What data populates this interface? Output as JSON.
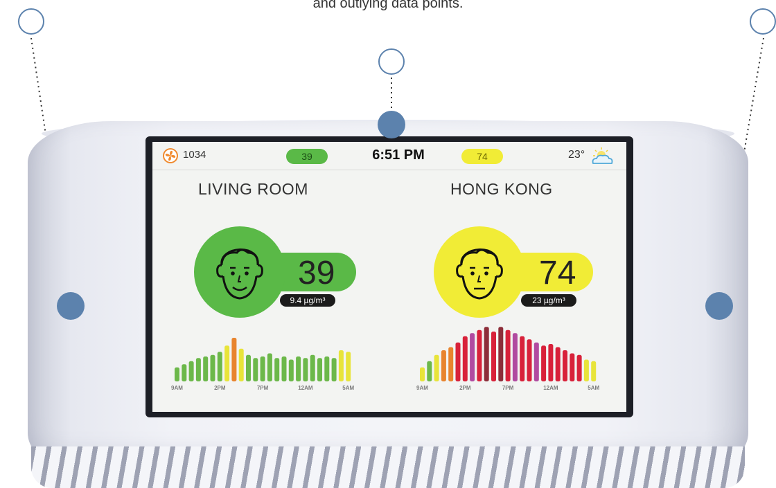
{
  "caption": "and outlying data points.",
  "status_bar": {
    "fan_icon": "fan-icon",
    "fan_count": "1034",
    "indoor_aqi": "39",
    "time": "6:51 PM",
    "outdoor_aqi": "74",
    "temperature": "23°",
    "weather_icon": "partly-cloudy-icon"
  },
  "indoor": {
    "location": "LIVING ROOM",
    "face_icon": "happy-face-icon",
    "aqi": "39",
    "concentration": "9.4 µg/m³",
    "color": "#5ab947"
  },
  "outdoor": {
    "location": "HONG KONG",
    "face_icon": "neutral-face-icon",
    "aqi": "74",
    "concentration": "23 µg/m³",
    "color": "#f1ec36"
  },
  "chart_data": [
    {
      "type": "bar",
      "categories": [
        "9AM",
        "2PM",
        "7PM",
        "12AM",
        "5AM"
      ],
      "values": [
        18,
        22,
        26,
        30,
        32,
        34,
        38,
        46,
        56,
        42,
        34,
        30,
        32,
        36,
        30,
        32,
        28,
        32,
        30,
        34,
        30,
        32,
        30,
        40,
        38
      ],
      "colors": [
        "#6cb84a",
        "#6cb84a",
        "#6cb84a",
        "#6cb84a",
        "#6cb84a",
        "#6cb84a",
        "#6cb84a",
        "#e8e43a",
        "#e8842e",
        "#e8e43a",
        "#6cb84a",
        "#6cb84a",
        "#6cb84a",
        "#6cb84a",
        "#6cb84a",
        "#6cb84a",
        "#6cb84a",
        "#6cb84a",
        "#6cb84a",
        "#6cb84a",
        "#6cb84a",
        "#6cb84a",
        "#6cb84a",
        "#e8e43a",
        "#e8e43a"
      ],
      "ylim": [
        0,
        80
      ]
    },
    {
      "type": "bar",
      "categories": [
        "9AM",
        "2PM",
        "7PM",
        "12AM",
        "5AM"
      ],
      "values": [
        18,
        26,
        34,
        40,
        44,
        50,
        58,
        62,
        66,
        70,
        64,
        70,
        66,
        62,
        58,
        54,
        50,
        46,
        48,
        44,
        40,
        36,
        34,
        28,
        26
      ],
      "colors": [
        "#e8e43a",
        "#6cb84a",
        "#e8e43a",
        "#e8842e",
        "#e8842e",
        "#d8213a",
        "#d8213a",
        "#b14aa0",
        "#d8213a",
        "#8d2e3a",
        "#d8213a",
        "#8d2e3a",
        "#d8213a",
        "#b14aa0",
        "#d8213a",
        "#d8213a",
        "#b14aa0",
        "#d8213a",
        "#d8213a",
        "#d8213a",
        "#d8213a",
        "#d8213a",
        "#d8213a",
        "#e8e43a",
        "#e8e43a"
      ],
      "ylim": [
        0,
        80
      ]
    }
  ],
  "annotations": {
    "accent": "#5c82ad"
  }
}
